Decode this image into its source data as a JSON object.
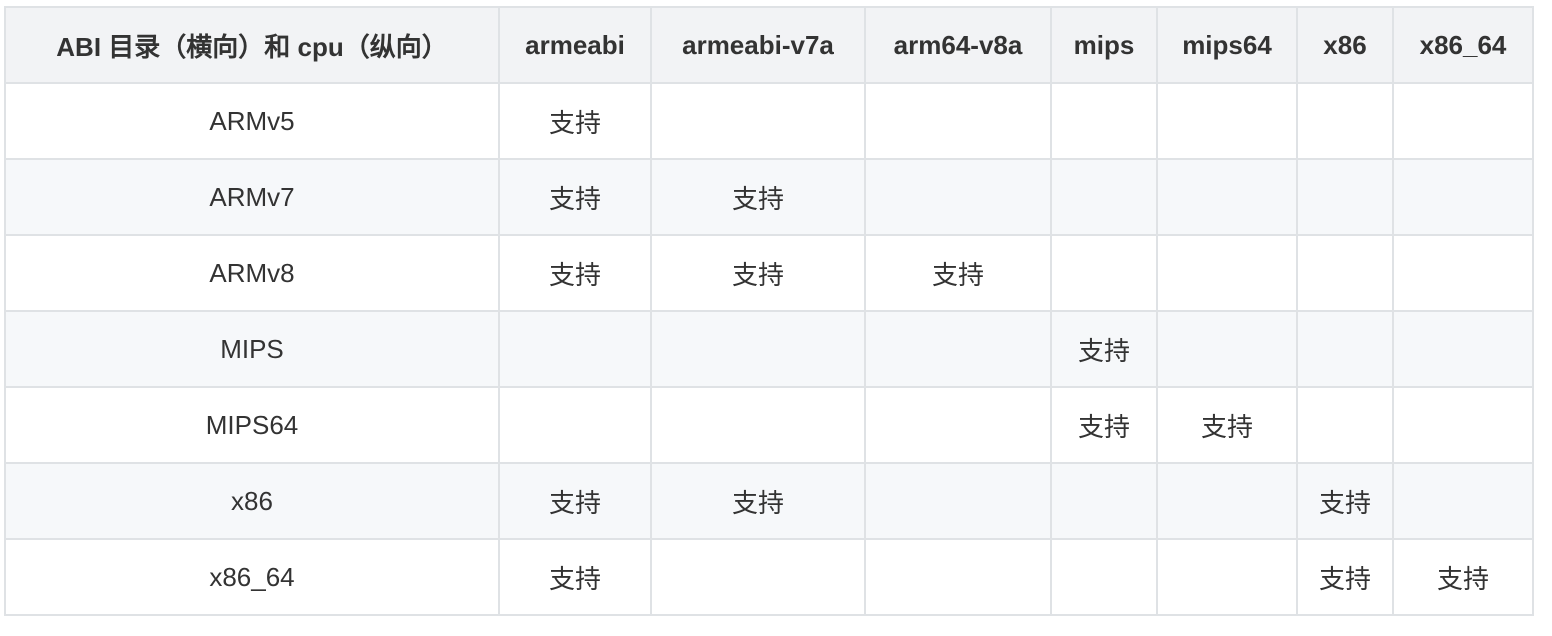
{
  "table": {
    "headers": [
      "ABI 目录（横向）和 cpu（纵向）",
      "armeabi",
      "armeabi-v7a",
      "arm64-v8a",
      "mips",
      "mips64",
      "x86",
      "x86_64"
    ],
    "rows": [
      [
        "ARMv5",
        "支持",
        "",
        "",
        "",
        "",
        "",
        ""
      ],
      [
        "ARMv7",
        "支持",
        "支持",
        "",
        "",
        "",
        "",
        ""
      ],
      [
        "ARMv8",
        "支持",
        "支持",
        "支持",
        "",
        "",
        "",
        ""
      ],
      [
        "MIPS",
        "",
        "",
        "",
        "支持",
        "",
        "",
        ""
      ],
      [
        "MIPS64",
        "",
        "",
        "",
        "支持",
        "支持",
        "",
        ""
      ],
      [
        "x86",
        "支持",
        "支持",
        "",
        "",
        "",
        "支持",
        ""
      ],
      [
        "x86_64",
        "支持",
        "",
        "",
        "",
        "",
        "支持",
        "支持"
      ]
    ]
  }
}
